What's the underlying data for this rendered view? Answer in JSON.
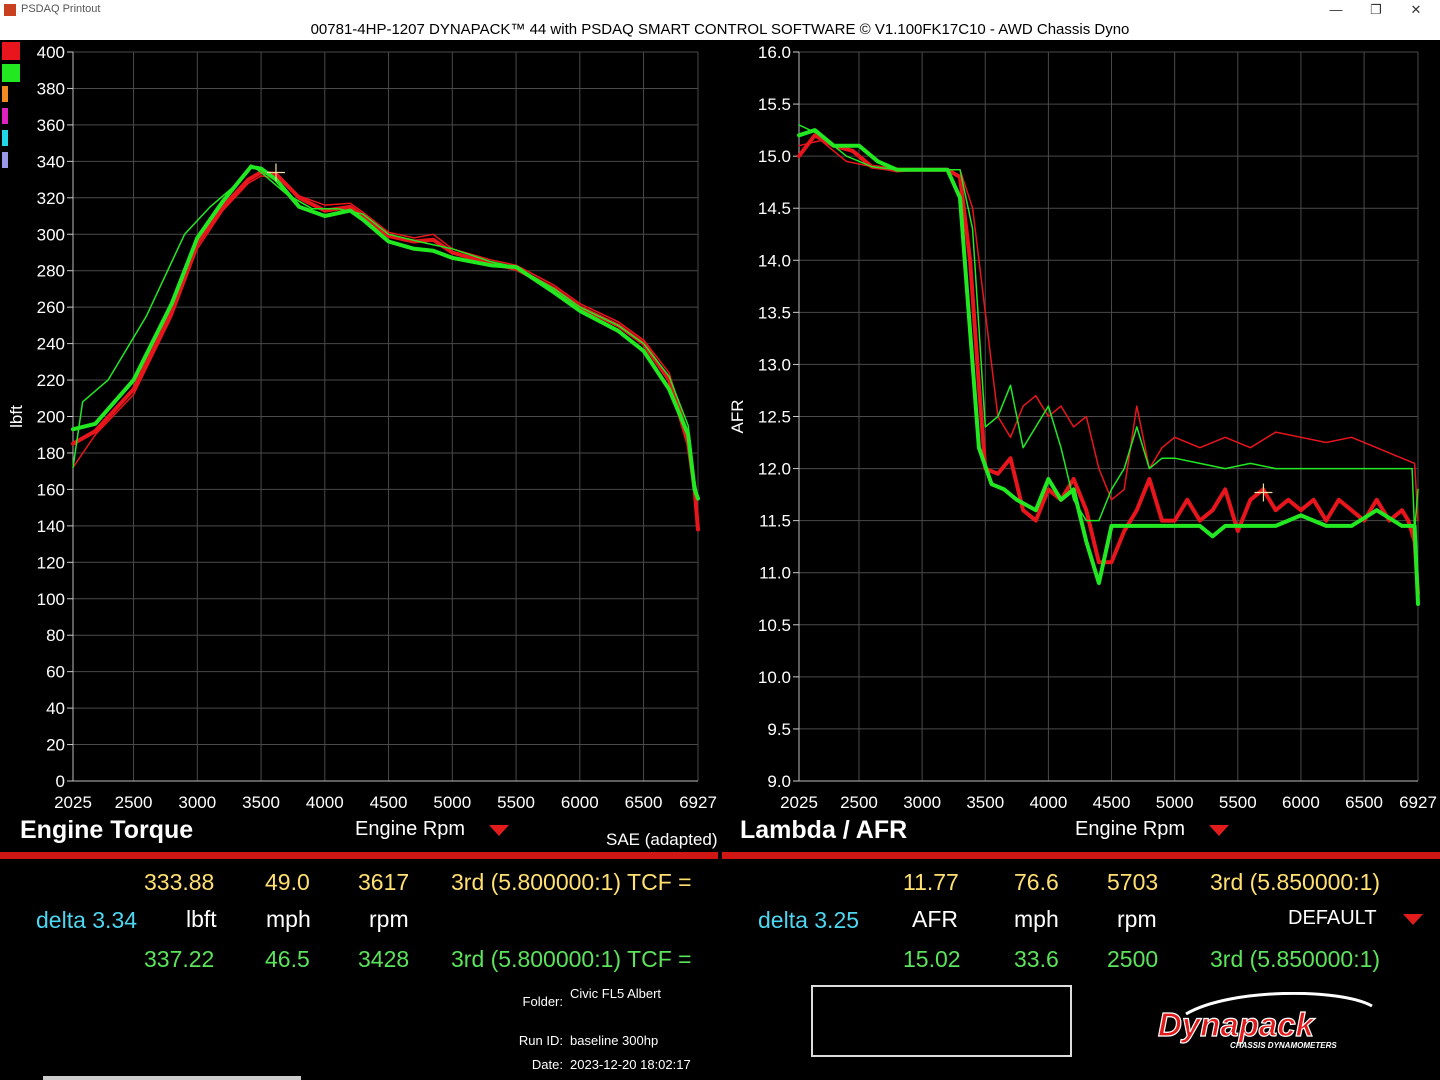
{
  "window": {
    "title": "PSDAQ Printout",
    "minimize": "—",
    "restore": "❐",
    "close": "✕"
  },
  "header": {
    "subtitle": "00781-4HP-1207 DYNAPACK™ 44 with PSDAQ SMART CONTROL SOFTWARE © V1.100FK17C10 - AWD Chassis Dyno"
  },
  "colors": {
    "red": "#e8161c",
    "green": "#22e822",
    "orange": "#f08a20",
    "magenta": "#e020c0",
    "cyan": "#20d8e8",
    "lavender": "#9999e8"
  },
  "chart_data": [
    {
      "type": "line",
      "title": "Engine Torque",
      "xlabel": "Engine Rpm",
      "ylabel": "lbft",
      "note": "SAE (adapted)",
      "xlim": [
        2025,
        6927
      ],
      "ylim": [
        0,
        400
      ],
      "x_ticks": [
        2025,
        2500,
        3000,
        3500,
        4000,
        4500,
        5000,
        5500,
        6000,
        6500,
        6927
      ],
      "y_ticks": [
        0,
        20,
        40,
        60,
        80,
        100,
        120,
        140,
        160,
        180,
        200,
        220,
        240,
        260,
        280,
        300,
        320,
        340,
        360,
        380,
        400
      ],
      "grid": true,
      "cursor": {
        "x": 3617,
        "y": 333.88
      },
      "series": [
        {
          "color": "red",
          "width": 4,
          "x": [
            2025,
            2200,
            2500,
            2800,
            3000,
            3200,
            3400,
            3500,
            3617,
            3800,
            4000,
            4200,
            4300,
            4500,
            4700,
            4850,
            5000,
            5300,
            5500,
            5800,
            6000,
            6300,
            6500,
            6700,
            6850,
            6900,
            6927
          ],
          "y": [
            185,
            192,
            215,
            258,
            295,
            315,
            330,
            334,
            333,
            320,
            313,
            315,
            310,
            299,
            296,
            297,
            290,
            284,
            281,
            270,
            260,
            250,
            240,
            220,
            185,
            160,
            138
          ]
        },
        {
          "color": "red",
          "width": 1.5,
          "x": [
            2025,
            2200,
            2500,
            2800,
            3000,
            3200,
            3400,
            3500,
            3617,
            3800,
            4000,
            4200,
            4300,
            4500,
            4700,
            4850,
            5000,
            5300,
            5500,
            5800,
            6000,
            6300,
            6500,
            6700,
            6850,
            6900,
            6927
          ],
          "y": [
            172,
            190,
            212,
            255,
            292,
            313,
            328,
            332,
            331,
            321,
            316,
            317,
            312,
            301,
            298,
            300,
            292,
            286,
            283,
            272,
            262,
            252,
            242,
            224,
            190,
            165,
            140
          ]
        },
        {
          "color": "green",
          "width": 4,
          "x": [
            2025,
            2200,
            2500,
            2800,
            3000,
            3200,
            3420,
            3500,
            3617,
            3800,
            4000,
            4200,
            4300,
            4500,
            4700,
            4850,
            5000,
            5300,
            5500,
            5800,
            6000,
            6300,
            6500,
            6700,
            6850,
            6900,
            6927
          ],
          "y": [
            193,
            196,
            220,
            262,
            298,
            318,
            337,
            336,
            330,
            315,
            310,
            313,
            308,
            296,
            292,
            291,
            287,
            283,
            282,
            268,
            258,
            247,
            236,
            215,
            190,
            160,
            155
          ]
        },
        {
          "color": "green",
          "width": 1.5,
          "x": [
            2025,
            2100,
            2300,
            2600,
            2900,
            3100,
            3300,
            3420,
            3500,
            3700,
            3900,
            4100,
            4300,
            4500,
            4800,
            5000,
            5300,
            5500,
            5800,
            6000,
            6300,
            6500,
            6700,
            6850,
            6900,
            6927
          ],
          "y": [
            172,
            208,
            220,
            255,
            300,
            315,
            327,
            338,
            334,
            322,
            314,
            314,
            311,
            300,
            295,
            292,
            285,
            282,
            270,
            260,
            250,
            240,
            222,
            195,
            165,
            155
          ]
        }
      ]
    },
    {
      "type": "line",
      "title": "Lambda / AFR",
      "xlabel": "Engine Rpm",
      "ylabel": "AFR",
      "xlim": [
        2025,
        6927
      ],
      "ylim": [
        9.0,
        16.0
      ],
      "x_ticks": [
        2025,
        2500,
        3000,
        3500,
        4000,
        4500,
        5000,
        5500,
        6000,
        6500,
        6927
      ],
      "y_ticks": [
        9.0,
        9.5,
        10.0,
        10.5,
        11.0,
        11.5,
        12.0,
        12.5,
        13.0,
        13.5,
        14.0,
        14.5,
        15.0,
        15.5,
        16.0
      ],
      "grid": true,
      "cursor": {
        "x": 5703,
        "y": 11.77
      },
      "series": [
        {
          "color": "red",
          "width": 4,
          "x": [
            2025,
            2150,
            2300,
            2450,
            2600,
            2800,
            2950,
            3200,
            3300,
            3380,
            3450,
            3500,
            3600,
            3700,
            3800,
            3900,
            4000,
            4100,
            4200,
            4300,
            4400,
            4500,
            4600,
            4700,
            4800,
            4900,
            5000,
            5100,
            5200,
            5300,
            5400,
            5500,
            5600,
            5700,
            5800,
            5900,
            6000,
            6100,
            6200,
            6300,
            6400,
            6500,
            6600,
            6700,
            6800,
            6850,
            6900,
            6927
          ],
          "y": [
            15.0,
            15.2,
            15.1,
            15.05,
            14.9,
            14.87,
            14.87,
            14.87,
            14.8,
            14.0,
            12.8,
            12.0,
            11.95,
            12.1,
            11.6,
            11.5,
            11.8,
            11.7,
            11.9,
            11.6,
            11.1,
            11.1,
            11.4,
            11.6,
            11.9,
            11.5,
            11.5,
            11.7,
            11.5,
            11.6,
            11.8,
            11.4,
            11.7,
            11.8,
            11.6,
            11.7,
            11.6,
            11.7,
            11.5,
            11.7,
            11.6,
            11.5,
            11.7,
            11.5,
            11.6,
            11.5,
            11.3,
            10.8
          ]
        },
        {
          "color": "red",
          "width": 1.5,
          "x": [
            2025,
            2200,
            2400,
            2600,
            2800,
            3000,
            3300,
            3400,
            3500,
            3600,
            3700,
            3800,
            3900,
            4000,
            4100,
            4200,
            4300,
            4400,
            4500,
            4600,
            4700,
            4800,
            4900,
            5000,
            5200,
            5400,
            5600,
            5800,
            6000,
            6200,
            6400,
            6600,
            6800,
            6900,
            6927
          ],
          "y": [
            15.1,
            15.15,
            14.95,
            14.9,
            14.85,
            14.87,
            14.87,
            14.5,
            13.5,
            12.5,
            12.3,
            12.6,
            12.7,
            12.5,
            12.6,
            12.4,
            12.5,
            12.0,
            11.7,
            11.8,
            12.6,
            12.0,
            12.2,
            12.3,
            12.2,
            12.3,
            12.2,
            12.35,
            12.3,
            12.25,
            12.3,
            12.2,
            12.1,
            12.05,
            11.5
          ]
        },
        {
          "color": "green",
          "width": 4,
          "x": [
            2025,
            2150,
            2300,
            2500,
            2650,
            2800,
            3000,
            3200,
            3300,
            3400,
            3450,
            3550,
            3650,
            3750,
            3900,
            4000,
            4100,
            4200,
            4300,
            4400,
            4500,
            4600,
            4700,
            4800,
            5000,
            5200,
            5300,
            5400,
            5600,
            5800,
            6000,
            6200,
            6400,
            6600,
            6800,
            6900,
            6927
          ],
          "y": [
            15.2,
            15.25,
            15.1,
            15.1,
            14.95,
            14.87,
            14.87,
            14.87,
            14.6,
            13.0,
            12.2,
            11.85,
            11.8,
            11.7,
            11.6,
            11.9,
            11.7,
            11.8,
            11.3,
            10.9,
            11.45,
            11.45,
            11.45,
            11.45,
            11.45,
            11.45,
            11.35,
            11.45,
            11.45,
            11.45,
            11.55,
            11.45,
            11.45,
            11.6,
            11.45,
            11.45,
            10.7
          ]
        },
        {
          "color": "green",
          "width": 1.5,
          "x": [
            2025,
            2200,
            2400,
            2600,
            2800,
            3000,
            3200,
            3300,
            3400,
            3500,
            3600,
            3700,
            3800,
            3900,
            4000,
            4100,
            4200,
            4300,
            4400,
            4500,
            4600,
            4700,
            4800,
            4900,
            5000,
            5200,
            5400,
            5600,
            5800,
            6000,
            6200,
            6400,
            6600,
            6800,
            6880,
            6900,
            6927
          ],
          "y": [
            15.3,
            15.2,
            15.0,
            14.9,
            14.87,
            14.87,
            14.87,
            14.87,
            14.3,
            12.4,
            12.5,
            12.8,
            12.2,
            12.4,
            12.6,
            12.2,
            11.7,
            11.5,
            11.5,
            11.8,
            12.0,
            12.4,
            12.0,
            12.1,
            12.1,
            12.05,
            12.0,
            12.05,
            12.0,
            12.0,
            12.0,
            12.0,
            12.0,
            12.0,
            12.0,
            11.4,
            11.8
          ]
        }
      ]
    }
  ],
  "legend_colors": [
    "red",
    "green",
    "orange",
    "magenta",
    "cyan",
    "lavender"
  ],
  "left_panel": {
    "title": "Engine Torque",
    "xlabel": "Engine Rpm",
    "note": "SAE (adapted)",
    "row1": {
      "value": "333.88",
      "speed": "49.0",
      "rpm": "3617",
      "gear": "3rd (5.800000:1) TCF ="
    },
    "row2": {
      "delta": "delta 3.34",
      "unit": "lbft",
      "speed_unit": "mph",
      "rpm_unit": "rpm"
    },
    "row3": {
      "value": "337.22",
      "speed": "46.5",
      "rpm": "3428",
      "gear": "3rd (5.800000:1) TCF ="
    }
  },
  "right_panel": {
    "title": "Lambda / AFR",
    "xlabel": "Engine Rpm",
    "row1": {
      "value": "11.77",
      "speed": "76.6",
      "rpm": "5703",
      "gear": "3rd (5.850000:1)"
    },
    "row2": {
      "delta": "delta 3.25",
      "unit": "AFR",
      "speed_unit": "mph",
      "rpm_unit": "rpm",
      "preset": "DEFAULT"
    },
    "row3": {
      "value": "15.02",
      "speed": "33.6",
      "rpm": "2500",
      "gear": "3rd (5.850000:1)"
    }
  },
  "info": {
    "folder_label": "Folder:",
    "folder": "Civic FL5 Albert",
    "run_label": "Run ID:",
    "run": "baseline 300hp",
    "date_label": "Date:",
    "date": "2023-12-20 18:02:17"
  },
  "logo": {
    "brand": "Dynapack",
    "tagline": "CHASSIS DYNAMOMETERS"
  }
}
